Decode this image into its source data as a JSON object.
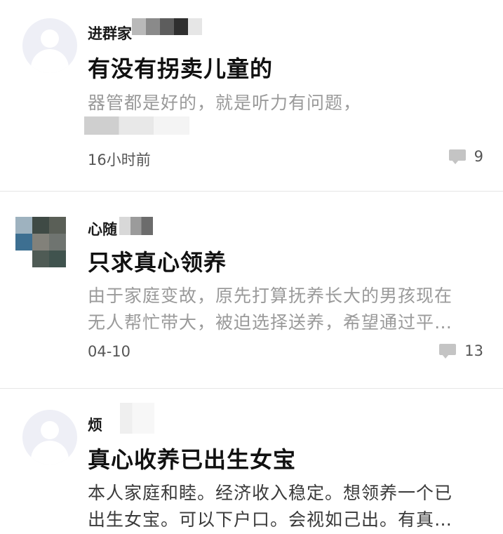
{
  "posts": [
    {
      "username": "进群家",
      "title": "有没有拐卖儿童的",
      "excerpt": [
        "器管都是好的，就是听力有问题，"
      ],
      "time": "16小时前",
      "comment_count": "9",
      "avatar": "default-avatar-icon"
    },
    {
      "username": "心随",
      "title": "只求真心领养",
      "excerpt": [
        "由于家庭变故，原先打算抚养长大的男孩现在",
        "无人帮忙带大，被迫选择送养，希望通过平…"
      ],
      "time": "04-10",
      "comment_count": "13",
      "avatar": "pixelated-avatar"
    },
    {
      "username": "烦",
      "title": "真心收养已出生女宝",
      "excerpt": [
        "本人家庭和睦。经济收入稳定。想领养一个已",
        "出生女宝。可以下户口。会视如己出。有真…"
      ],
      "avatar": "default-avatar-icon"
    }
  ],
  "colors": {
    "divider": "#e6e6e6",
    "excerpt_grey": "#9a9a9a",
    "comment_icon": "#c4c4c4"
  }
}
